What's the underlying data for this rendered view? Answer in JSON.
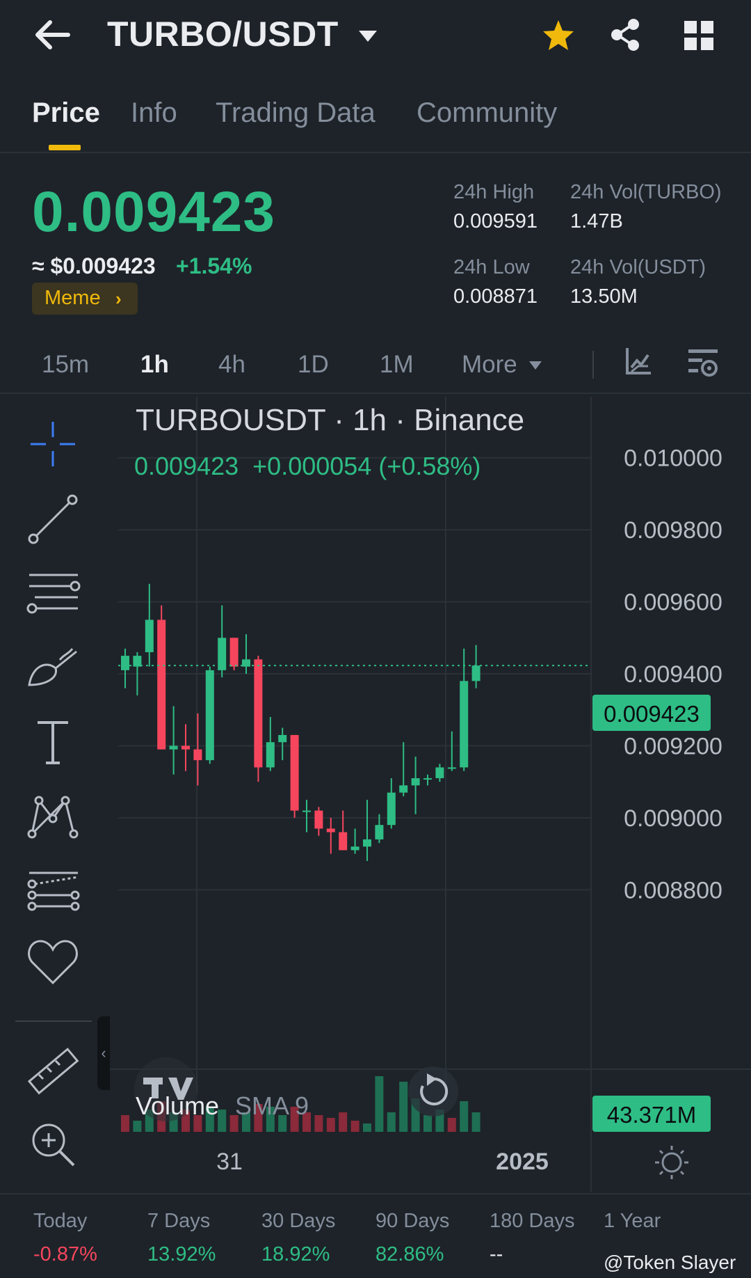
{
  "header": {
    "pair": "TURBO/USDT",
    "favorite": true,
    "icons": [
      "back-arrow-icon",
      "caret-down-icon",
      "star-icon",
      "share-icon",
      "grid-icon"
    ],
    "star_color": "#f0b90b"
  },
  "tabs": [
    {
      "label": "Price",
      "active": true
    },
    {
      "label": "Info",
      "active": false
    },
    {
      "label": "Trading Data",
      "active": false
    },
    {
      "label": "Community",
      "active": false
    }
  ],
  "ticker": {
    "last_price": "0.009423",
    "usd_price": "≈ $0.009423",
    "change_pct": "+1.54%",
    "tag": "Meme",
    "stats": {
      "high_label": "24h High",
      "high": "0.009591",
      "vol_base_label": "24h Vol(TURBO)",
      "vol_base": "1.47B",
      "low_label": "24h Low",
      "low": "0.008871",
      "vol_quote_label": "24h Vol(USDT)",
      "vol_quote": "13.50M"
    }
  },
  "intervals": [
    {
      "label": "15m",
      "active": false
    },
    {
      "label": "1h",
      "active": true
    },
    {
      "label": "4h",
      "active": false
    },
    {
      "label": "1D",
      "active": false
    },
    {
      "label": "1M",
      "active": false
    },
    {
      "label": "More",
      "active": false
    }
  ],
  "toolbar_tools": [
    "crosshair-icon",
    "trend-line-icon",
    "fib-levels-icon",
    "brush-icon",
    "text-tool-icon",
    "pattern-icon",
    "projection-icon",
    "favorites-heart-icon",
    "ruler-icon",
    "zoom-in-icon"
  ],
  "chart_data": {
    "type": "candlestick",
    "title": "TURBOUSDT · 1h · Binance",
    "legend_line": "0.009423  +0.000054 (+0.58%)",
    "ylim": [
      0.0087,
      0.0101
    ],
    "yticks": [
      "0.010000",
      "0.009800",
      "0.009600",
      "0.009400",
      "0.009200",
      "0.009000",
      "0.008800"
    ],
    "xticks": [
      "31",
      "2025"
    ],
    "current_price_label": "0.009423",
    "volume_label": "Volume",
    "volume_sma_label": "SMA 9",
    "volume_value_label": "43.371M",
    "up_color": "#2ebd85",
    "down_color": "#f6465d",
    "candles": [
      {
        "o": 0.00941,
        "h": 0.00947,
        "l": 0.00936,
        "c": 0.00945
      },
      {
        "o": 0.00942,
        "h": 0.00946,
        "l": 0.00934,
        "c": 0.00945
      },
      {
        "o": 0.00946,
        "h": 0.00965,
        "l": 0.00942,
        "c": 0.00955
      },
      {
        "o": 0.00955,
        "h": 0.00959,
        "l": 0.00919,
        "c": 0.00919
      },
      {
        "o": 0.00919,
        "h": 0.00931,
        "l": 0.00912,
        "c": 0.0092
      },
      {
        "o": 0.0092,
        "h": 0.00926,
        "l": 0.00913,
        "c": 0.00919
      },
      {
        "o": 0.00919,
        "h": 0.00929,
        "l": 0.00909,
        "c": 0.00916
      },
      {
        "o": 0.00916,
        "h": 0.00942,
        "l": 0.00915,
        "c": 0.00941
      },
      {
        "o": 0.00941,
        "h": 0.00959,
        "l": 0.00939,
        "c": 0.0095
      },
      {
        "o": 0.0095,
        "h": 0.0095,
        "l": 0.00941,
        "c": 0.00942
      },
      {
        "o": 0.00942,
        "h": 0.00951,
        "l": 0.0094,
        "c": 0.00944
      },
      {
        "o": 0.00944,
        "h": 0.00945,
        "l": 0.0091,
        "c": 0.00914
      },
      {
        "o": 0.00914,
        "h": 0.00928,
        "l": 0.00913,
        "c": 0.00921
      },
      {
        "o": 0.00921,
        "h": 0.00925,
        "l": 0.00916,
        "c": 0.00923
      },
      {
        "o": 0.00923,
        "h": 0.00923,
        "l": 0.009,
        "c": 0.00902
      },
      {
        "o": 0.00902,
        "h": 0.00905,
        "l": 0.00896,
        "c": 0.00902
      },
      {
        "o": 0.00902,
        "h": 0.00903,
        "l": 0.00895,
        "c": 0.00897
      },
      {
        "o": 0.00897,
        "h": 0.009,
        "l": 0.0089,
        "c": 0.00896
      },
      {
        "o": 0.00896,
        "h": 0.00902,
        "l": 0.00891,
        "c": 0.00891
      },
      {
        "o": 0.00891,
        "h": 0.00897,
        "l": 0.0089,
        "c": 0.00892
      },
      {
        "o": 0.00892,
        "h": 0.00905,
        "l": 0.00888,
        "c": 0.00894
      },
      {
        "o": 0.00894,
        "h": 0.00901,
        "l": 0.00893,
        "c": 0.00898
      },
      {
        "o": 0.00898,
        "h": 0.00911,
        "l": 0.00897,
        "c": 0.00907
      },
      {
        "o": 0.00907,
        "h": 0.00921,
        "l": 0.00906,
        "c": 0.00909
      },
      {
        "o": 0.00909,
        "h": 0.00917,
        "l": 0.00901,
        "c": 0.00911
      },
      {
        "o": 0.00911,
        "h": 0.00912,
        "l": 0.00909,
        "c": 0.00911
      },
      {
        "o": 0.00911,
        "h": 0.00915,
        "l": 0.0091,
        "c": 0.00914
      },
      {
        "o": 0.00914,
        "h": 0.00924,
        "l": 0.00913,
        "c": 0.00914
      },
      {
        "o": 0.00914,
        "h": 0.00947,
        "l": 0.00913,
        "c": 0.00938
      },
      {
        "o": 0.00938,
        "h": 0.00948,
        "l": 0.00936,
        "c": 0.009423
      }
    ],
    "volumes": [
      {
        "v": 0.3,
        "up": false
      },
      {
        "v": 0.2,
        "up": true
      },
      {
        "v": 0.4,
        "up": true
      },
      {
        "v": 0.55,
        "up": false
      },
      {
        "v": 0.35,
        "up": true
      },
      {
        "v": 0.4,
        "up": false
      },
      {
        "v": 0.3,
        "up": false
      },
      {
        "v": 0.45,
        "up": true
      },
      {
        "v": 0.4,
        "up": true
      },
      {
        "v": 0.3,
        "up": false
      },
      {
        "v": 0.35,
        "up": true
      },
      {
        "v": 0.5,
        "up": false
      },
      {
        "v": 0.45,
        "up": true
      },
      {
        "v": 0.3,
        "up": true
      },
      {
        "v": 0.45,
        "up": false
      },
      {
        "v": 0.35,
        "up": false
      },
      {
        "v": 0.3,
        "up": false
      },
      {
        "v": 0.25,
        "up": false
      },
      {
        "v": 0.35,
        "up": false
      },
      {
        "v": 0.2,
        "up": false
      },
      {
        "v": 0.15,
        "up": true
      },
      {
        "v": 1.0,
        "up": true
      },
      {
        "v": 0.35,
        "up": true
      },
      {
        "v": 0.9,
        "up": true
      },
      {
        "v": 0.6,
        "up": true
      },
      {
        "v": 0.3,
        "up": true
      },
      {
        "v": 0.4,
        "up": true
      },
      {
        "v": 0.25,
        "up": false
      },
      {
        "v": 0.55,
        "up": true
      },
      {
        "v": 0.35,
        "up": true
      }
    ]
  },
  "returns": [
    {
      "label": "Today",
      "value": "-0.87%",
      "color": "#f6465d"
    },
    {
      "label": "7 Days",
      "value": "13.92%",
      "color": "#2ebd85"
    },
    {
      "label": "30 Days",
      "value": "18.92%",
      "color": "#2ebd85"
    },
    {
      "label": "90 Days",
      "value": "82.86%",
      "color": "#2ebd85"
    },
    {
      "label": "180 Days",
      "value": "--",
      "color": "#eaecef"
    },
    {
      "label": "1 Year",
      "value": "",
      "color": "#eaecef"
    }
  ],
  "watermark": "@Token Slayer"
}
